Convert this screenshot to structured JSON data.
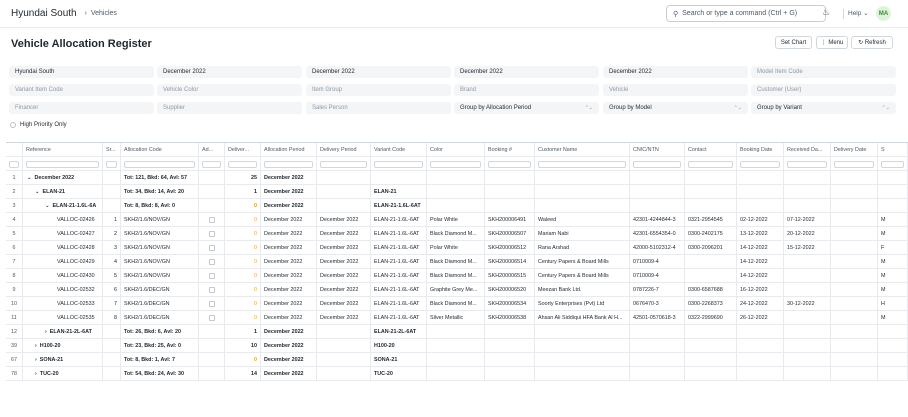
{
  "nav": {
    "brand": "Hyundai South",
    "crumb": "Vehicles",
    "search_placeholder": "Search or type a command (Ctrl + G)",
    "help": "Help",
    "avatar": "MA"
  },
  "page": {
    "title": "Vehicle Allocation Register",
    "set_chart": "Set Chart",
    "menu": "Menu",
    "refresh": "Refresh"
  },
  "filters": [
    {
      "value": "Hyundai South",
      "placeholder": false,
      "select": false
    },
    {
      "value": "December 2022",
      "placeholder": false,
      "select": false
    },
    {
      "value": "December 2022",
      "placeholder": false,
      "select": false
    },
    {
      "value": "December 2022",
      "placeholder": false,
      "select": false
    },
    {
      "value": "December 2022",
      "placeholder": false,
      "select": false
    },
    {
      "value": "Model Item Code",
      "placeholder": true,
      "select": false
    },
    {
      "value": "Variant Item Code",
      "placeholder": true,
      "select": false
    },
    {
      "value": "Vehicle Color",
      "placeholder": true,
      "select": false
    },
    {
      "value": "Item Group",
      "placeholder": true,
      "select": false
    },
    {
      "value": "Brand",
      "placeholder": true,
      "select": false
    },
    {
      "value": "Vehicle",
      "placeholder": true,
      "select": false
    },
    {
      "value": "Customer (User)",
      "placeholder": true,
      "select": false
    },
    {
      "value": "Financer",
      "placeholder": true,
      "select": false
    },
    {
      "value": "Supplier",
      "placeholder": true,
      "select": false
    },
    {
      "value": "Sales Person",
      "placeholder": true,
      "select": false
    },
    {
      "value": "Group by Allocation Period",
      "placeholder": false,
      "select": true
    },
    {
      "value": "Group by Model",
      "placeholder": false,
      "select": true
    },
    {
      "value": "Group by Variant",
      "placeholder": false,
      "select": true
    }
  ],
  "high_priority": "High Priority Only",
  "columns": [
    "",
    "Reference",
    "Sr...",
    "Allocation Code",
    "Ad...",
    "Deliver...",
    "Allocation Period",
    "Delivery Period",
    "Variant Code",
    "Color",
    "Booking #",
    "Customer Name",
    "CNIC/NTN",
    "Contact",
    "Booking Date",
    "Received Da...",
    "Delivery Date",
    "S"
  ],
  "rows": [
    {
      "rn": "1",
      "type": "g0",
      "exp": "v",
      "ref": "December 2022",
      "code": "Tot: 121, Bkd: 64, Avl: 57",
      "dlv": "25",
      "ap": "December 2022"
    },
    {
      "rn": "2",
      "type": "g1",
      "exp": "v",
      "ref": "ELAN-21",
      "code": "Tot: 34, Bkd: 14, Avl: 20",
      "dlv": "1",
      "ap": "December 2022",
      "vc": "ELAN-21"
    },
    {
      "rn": "3",
      "type": "g2",
      "exp": "v",
      "ref": "ELAN-21-1.6L-6A",
      "code": "Tot: 8, Bkd: 8, Avl: 0",
      "dlv": "0",
      "ap": "December 2022",
      "vc": "ELAN-21-1.6L-6AT"
    },
    {
      "rn": "4",
      "type": "d",
      "ref": "VALLOC-02426",
      "sr": "1",
      "code": "SKH2/1.6/NOV/GN",
      "dlv": "0",
      "ap": "December 2022",
      "dp": "December 2022",
      "vc": "ELAN-21-1.6L-6AT",
      "color": "Polar White",
      "bk": "SKH200006491",
      "cust": "Waleed",
      "cnic": "42301-4244844-3",
      "contact": "0321-2954545",
      "bd": "02-12-2022",
      "rd": "07-12-2022",
      "s": "M"
    },
    {
      "rn": "5",
      "type": "d",
      "ref": "VALLOC-02427",
      "sr": "2",
      "code": "SKH2/1.6/NOV/GN",
      "dlv": "0",
      "ap": "December 2022",
      "dp": "December 2022",
      "vc": "ELAN-21-1.6L-6AT",
      "color": "Black Diamond M...",
      "bk": "SKH200006507",
      "cust": "Mariam Nabi",
      "cnic": "42301-6554354-0",
      "contact": "0300-2402175",
      "bd": "13-12-2022",
      "rd": "20-12-2022",
      "s": "M"
    },
    {
      "rn": "6",
      "type": "d",
      "ref": "VALLOC-02428",
      "sr": "3",
      "code": "SKH2/1.6/NOV/GN",
      "dlv": "0",
      "ap": "December 2022",
      "dp": "December 2022",
      "vc": "ELAN-21-1.6L-6AT",
      "color": "Polar White",
      "bk": "SKH200006512",
      "cust": "Rana Arshad",
      "cnic": "42000-5102312-4",
      "contact": "0300-2096201",
      "bd": "14-12-2022",
      "rd": "15-12-2022",
      "s": "F"
    },
    {
      "rn": "7",
      "type": "d",
      "ref": "VALLOC-02429",
      "sr": "4",
      "code": "SKH2/1.6/NOV/GN",
      "dlv": "0",
      "ap": "December 2022",
      "dp": "December 2022",
      "vc": "ELAN-21-1.6L-6AT",
      "color": "Black Diamond M...",
      "bk": "SKH200006514",
      "cust": "Century Papers & Board Mills",
      "cnic": "0710009-4",
      "contact": "",
      "bd": "14-12-2022",
      "rd": "",
      "s": "M"
    },
    {
      "rn": "8",
      "type": "d",
      "ref": "VALLOC-02430",
      "sr": "5",
      "code": "SKH2/1.6/NOV/GN",
      "dlv": "0",
      "ap": "December 2022",
      "dp": "December 2022",
      "vc": "ELAN-21-1.6L-6AT",
      "color": "Black Diamond M...",
      "bk": "SKH200006515",
      "cust": "Century Papers & Board Mills",
      "cnic": "0710009-4",
      "contact": "",
      "bd": "14-12-2022",
      "rd": "",
      "s": "M"
    },
    {
      "rn": "9",
      "type": "d",
      "ref": "VALLOC-02532",
      "sr": "6",
      "code": "SKH2/1.6/DEC/GN",
      "dlv": "0",
      "ap": "December 2022",
      "dp": "December 2022",
      "vc": "ELAN-21-1.6L-6AT",
      "color": "Graphite Grey Me...",
      "bk": "SKH200006520",
      "cust": "Meezan Bank Ltd.",
      "cnic": "0787226-7",
      "contact": "0300-6587688",
      "bd": "16-12-2022",
      "rd": "",
      "s": "M"
    },
    {
      "rn": "10",
      "type": "d",
      "ref": "VALLOC-02533",
      "sr": "7",
      "code": "SKH2/1.6/DEC/GN",
      "dlv": "0",
      "ap": "December 2022",
      "dp": "December 2022",
      "vc": "ELAN-21-1.6L-6AT",
      "color": "Black Diamond M...",
      "bk": "SKH200006534",
      "cust": "Soorty Enterprises (Pvt) Ltd",
      "cnic": "0676470-3",
      "contact": "0300-2268373",
      "bd": "24-12-2022",
      "rd": "30-12-2022",
      "s": "H"
    },
    {
      "rn": "11",
      "type": "d",
      "ref": "VALLOC-02535",
      "sr": "8",
      "code": "SKH2/1.6/DEC/GN",
      "dlv": "0",
      "ap": "December 2022",
      "dp": "December 2022",
      "vc": "ELAN-21-1.6L-6AT",
      "color": "Silver Metallic",
      "bk": "SKH200006538",
      "cust": "Ahsan Ali Siddiqui HFA Bank Al H...",
      "cnic": "42501-0570618-3",
      "contact": "0322-2999690",
      "bd": "26-12-2022",
      "rd": "",
      "s": "M"
    },
    {
      "rn": "12",
      "type": "g2",
      "exp": ">",
      "ref": "ELAN-21-2L-6AT",
      "code": "Tot: 26, Bkd: 6, Avl: 20",
      "dlv": "1",
      "ap": "December 2022",
      "vc": "ELAN-21-2L-6AT"
    },
    {
      "rn": "39",
      "type": "g1",
      "exp": ">",
      "ref": "H100-20",
      "code": "Tot: 23, Bkd: 25, Avl: 0",
      "dlv": "10",
      "ap": "December 2022",
      "vc": "H100-20"
    },
    {
      "rn": "67",
      "type": "g1",
      "exp": ">",
      "ref": "SONA-21",
      "code": "Tot: 8, Bkd: 1, Avl: 7",
      "dlv": "0",
      "ap": "December 2022",
      "vc": "SONA-21"
    },
    {
      "rn": "78",
      "type": "g1",
      "exp": ">",
      "ref": "TUC-20",
      "code": "Tot: 54, Bkd: 24, Avl: 30",
      "dlv": "14",
      "ap": "December 2022",
      "vc": "TUC-20"
    }
  ]
}
